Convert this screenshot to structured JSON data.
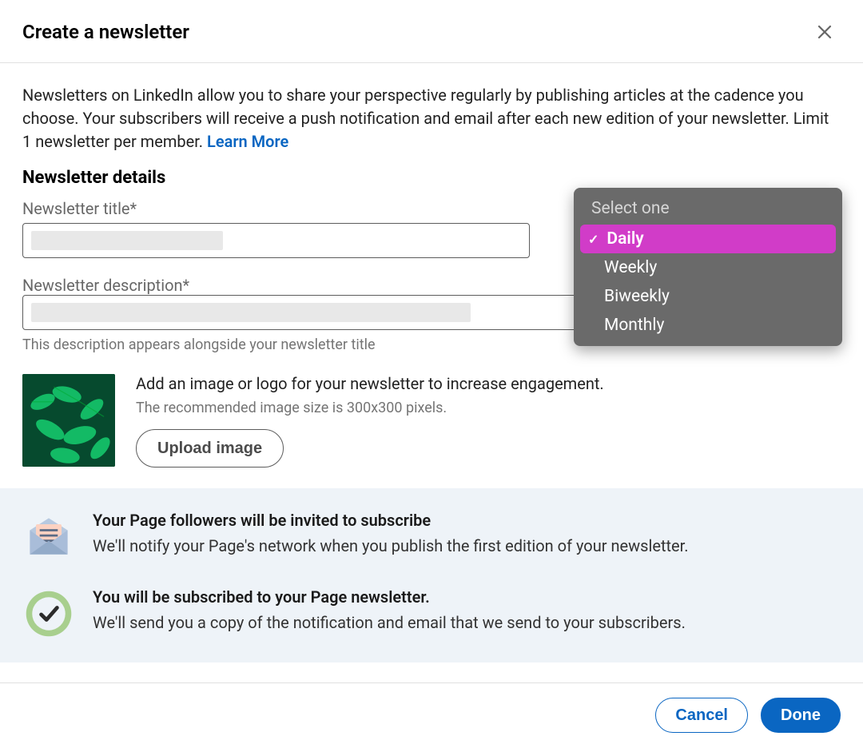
{
  "header": {
    "title": "Create a newsletter",
    "close_icon": "close-icon"
  },
  "intro": {
    "text": "Newsletters on LinkedIn allow you to share your perspective regularly by publishing articles at the cadence you choose. Your subscribers will receive a push notification and email after each new edition of your newsletter. Limit 1 newsletter per member. ",
    "learn_more_label": "Learn More"
  },
  "details": {
    "heading": "Newsletter details",
    "title_field": {
      "label": "Newsletter title*",
      "value": ""
    },
    "cadence_field": {
      "label_trailing_asterisk": "*",
      "dropdown": {
        "placeholder": "Select one",
        "options": [
          "Daily",
          "Weekly",
          "Biweekly",
          "Monthly"
        ],
        "selected": "Daily"
      }
    },
    "description_field": {
      "label": "Newsletter description*",
      "value": "",
      "helper": "This description appears alongside your newsletter title"
    },
    "image_upload": {
      "title": "Add an image or logo for your newsletter to increase engagement.",
      "subtitle": "The recommended image size is 300x300 pixels.",
      "button_label": "Upload image",
      "thumb_icon": "leaf-thumbnail"
    }
  },
  "info": {
    "item1": {
      "icon": "envelope-icon",
      "title": "Your Page followers will be invited to subscribe",
      "subtitle": "We'll notify your Page's network when you publish the first edition of your newsletter."
    },
    "item2": {
      "icon": "checkmark-circle-icon",
      "title": "You will be subscribed to your Page newsletter.",
      "subtitle": "We'll send you a copy of the notification and email that we send to your subscribers."
    }
  },
  "footer": {
    "cancel_label": "Cancel",
    "done_label": "Done"
  }
}
